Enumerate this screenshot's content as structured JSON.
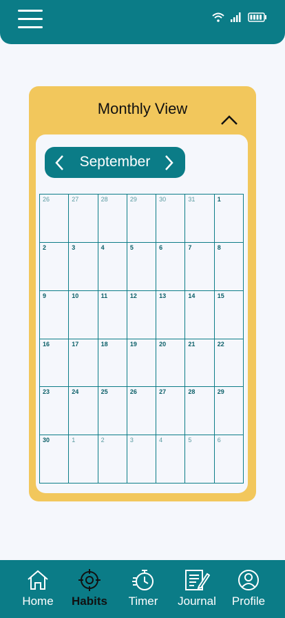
{
  "header": {
    "menu_icon": "hamburger-menu-icon",
    "status_icons": [
      "wifi-icon",
      "signal-icon",
      "battery-icon"
    ]
  },
  "card": {
    "title": "Monthly View",
    "collapse_icon": "chevron-up-icon",
    "month": "September",
    "prev_icon": "chevron-left-icon",
    "next_icon": "chevron-right-icon",
    "days": [
      {
        "d": "26",
        "cur": false
      },
      {
        "d": "27",
        "cur": false
      },
      {
        "d": "28",
        "cur": false
      },
      {
        "d": "29",
        "cur": false
      },
      {
        "d": "30",
        "cur": false
      },
      {
        "d": "31",
        "cur": false
      },
      {
        "d": "1",
        "cur": true
      },
      {
        "d": "2",
        "cur": true
      },
      {
        "d": "3",
        "cur": true
      },
      {
        "d": "4",
        "cur": true
      },
      {
        "d": "5",
        "cur": true
      },
      {
        "d": "6",
        "cur": true
      },
      {
        "d": "7",
        "cur": true
      },
      {
        "d": "8",
        "cur": true
      },
      {
        "d": "9",
        "cur": true
      },
      {
        "d": "10",
        "cur": true
      },
      {
        "d": "11",
        "cur": true
      },
      {
        "d": "12",
        "cur": true
      },
      {
        "d": "13",
        "cur": true
      },
      {
        "d": "14",
        "cur": true
      },
      {
        "d": "15",
        "cur": true
      },
      {
        "d": "16",
        "cur": true
      },
      {
        "d": "17",
        "cur": true
      },
      {
        "d": "18",
        "cur": true
      },
      {
        "d": "19",
        "cur": true
      },
      {
        "d": "20",
        "cur": true
      },
      {
        "d": "21",
        "cur": true
      },
      {
        "d": "22",
        "cur": true
      },
      {
        "d": "23",
        "cur": true
      },
      {
        "d": "24",
        "cur": true
      },
      {
        "d": "25",
        "cur": true
      },
      {
        "d": "26",
        "cur": true
      },
      {
        "d": "27",
        "cur": true
      },
      {
        "d": "28",
        "cur": true
      },
      {
        "d": "29",
        "cur": true
      },
      {
        "d": "30",
        "cur": true
      },
      {
        "d": "1",
        "cur": false
      },
      {
        "d": "2",
        "cur": false
      },
      {
        "d": "3",
        "cur": false
      },
      {
        "d": "4",
        "cur": false
      },
      {
        "d": "5",
        "cur": false
      },
      {
        "d": "6",
        "cur": false
      }
    ]
  },
  "nav": {
    "items": [
      {
        "label": "Home",
        "icon": "home-icon"
      },
      {
        "label": "Habits",
        "icon": "target-icon"
      },
      {
        "label": "Timer",
        "icon": "stopwatch-icon"
      },
      {
        "label": "Journal",
        "icon": "journal-icon"
      },
      {
        "label": "Profile",
        "icon": "profile-icon"
      }
    ],
    "active": "Habits"
  },
  "colors": {
    "primary": "#0b7c87",
    "accent": "#f2c75c",
    "background": "#f5f7fc"
  }
}
